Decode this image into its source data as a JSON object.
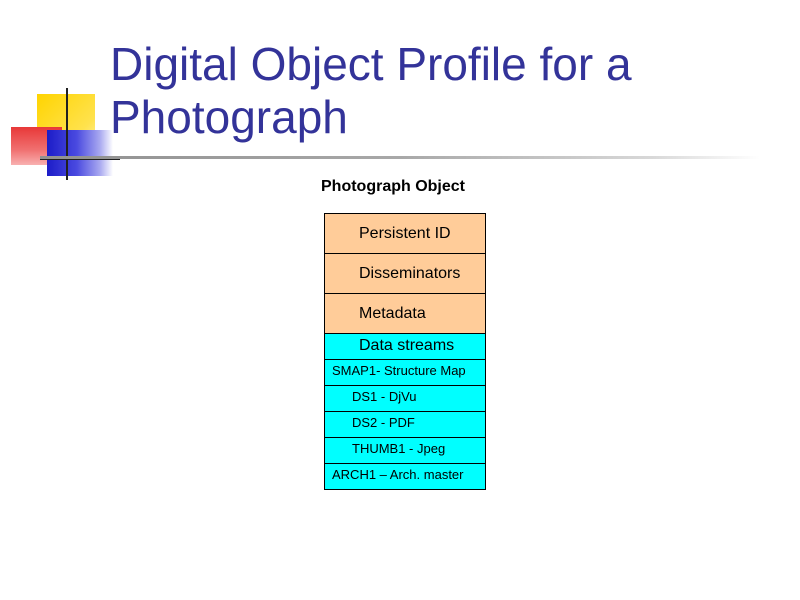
{
  "slide": {
    "title_lines": [
      "Digital Object Profile for a",
      "Photograph"
    ]
  },
  "diagram": {
    "object_title": "Photograph Object",
    "components": [
      {
        "label": "Persistent ID",
        "color": "#ffcc99"
      },
      {
        "label": "Disseminators",
        "color": "#ffcc99"
      },
      {
        "label": "Metadata",
        "color": "#ffcc99"
      },
      {
        "label": "Data streams",
        "color": "#00ffff"
      }
    ],
    "datastreams": [
      {
        "label": "SMAP1- Structure Map"
      },
      {
        "label": "DS1 - DjVu"
      },
      {
        "label": "DS2 - PDF"
      },
      {
        "label": "THUMB1 - Jpeg"
      },
      {
        "label": "ARCH1 – Arch. master"
      }
    ]
  },
  "colors": {
    "title": "#333399",
    "metadata_box": "#ffcc99",
    "datastream_box": "#00ffff"
  }
}
